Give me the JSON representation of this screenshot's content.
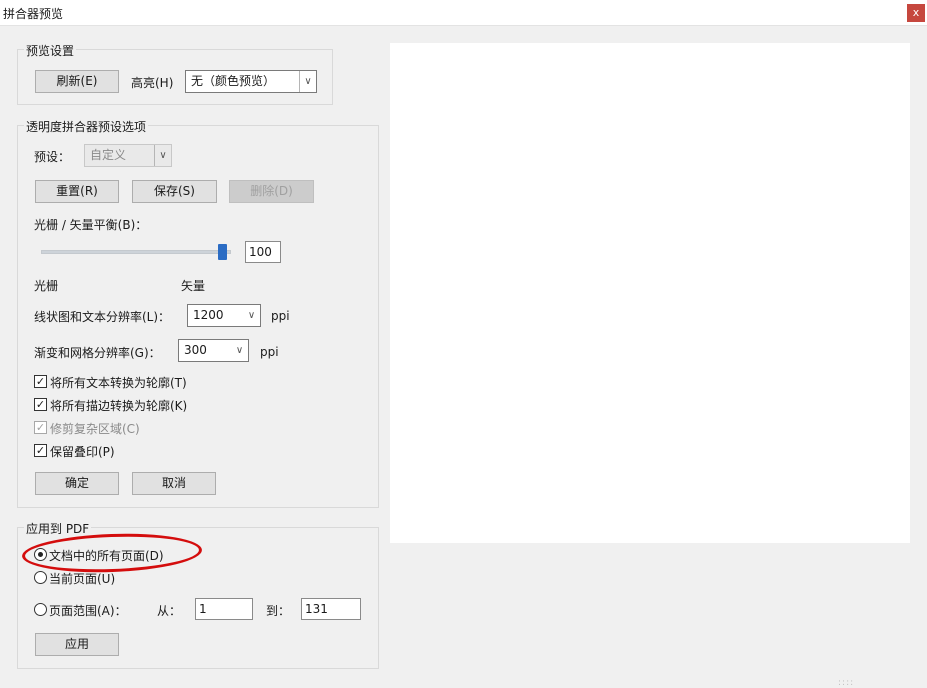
{
  "window": {
    "title": "拼合器预览",
    "close_label": "x"
  },
  "preview_settings": {
    "group_label": "预览设置",
    "refresh_label": "刷新(E)",
    "highlight_label": "高亮(H)",
    "highlight_value": "无（颜色预览）"
  },
  "preset_options": {
    "group_label": "透明度拼合器预设选项",
    "preset_label": "预设：",
    "preset_value": "自定义",
    "reset_label": "重置(R)",
    "save_label": "保存(S)",
    "delete_label": "删除(D)",
    "balance_label": "光栅 / 矢量平衡(B)：",
    "balance_value": "100",
    "balance_level": 1.0,
    "raster_label": "光栅",
    "vector_label": "矢量",
    "line_art_label": "线状图和文本分辨率(L)：",
    "line_art_value": "1200",
    "line_art_unit": "ppi",
    "gradient_label": "渐变和网格分辨率(G)：",
    "gradient_value": "300",
    "gradient_unit": "ppi",
    "checkboxes": [
      {
        "label": "将所有文本转换为轮廓(T)",
        "checked": true,
        "enabled": true
      },
      {
        "label": "将所有描边转换为轮廓(K)",
        "checked": true,
        "enabled": true
      },
      {
        "label": "修剪复杂区域(C)",
        "checked": true,
        "enabled": false
      },
      {
        "label": "保留叠印(P)",
        "checked": true,
        "enabled": true
      }
    ],
    "ok_label": "确定",
    "cancel_label": "取消"
  },
  "apply_to_pdf": {
    "group_label": "应用到 PDF",
    "all_pages_label": "文档中的所有页面(D)",
    "current_page_label": "当前页面(U)",
    "page_range_label": "页面范围(A)：",
    "selected": "all_pages",
    "from_label": "从：",
    "from_value": "1",
    "to_label": "到：",
    "to_value": "131",
    "apply_label": "应用"
  },
  "colors": {
    "annotation": "#d40d0d",
    "slider_thumb": "#2b6cc4",
    "close_button": "#c6473e"
  }
}
